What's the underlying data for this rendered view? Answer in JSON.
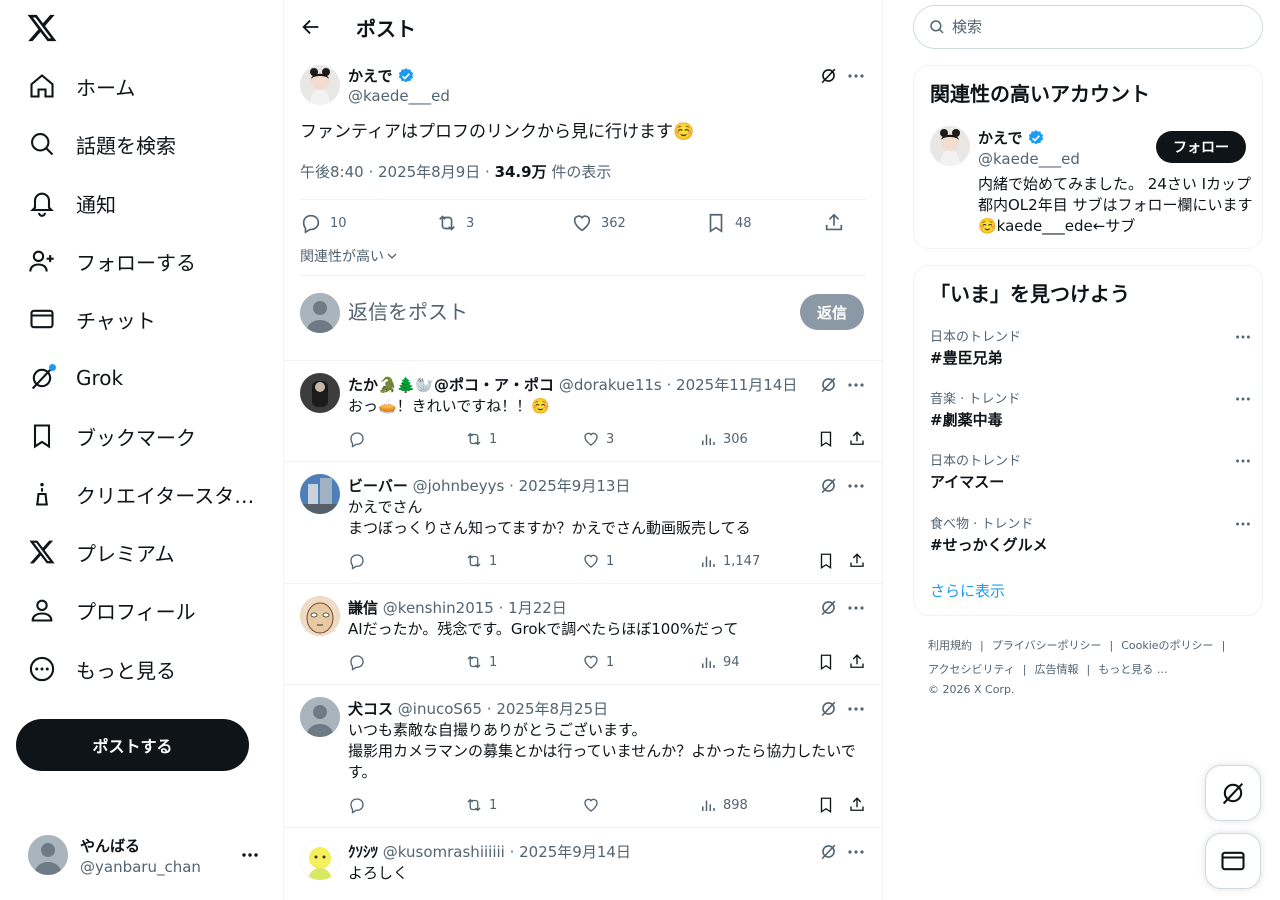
{
  "app": {
    "brand": "X",
    "accent": "#1d9bf0"
  },
  "nav": {
    "items": [
      {
        "label": "ホーム",
        "icon": "home-icon"
      },
      {
        "label": "話題を検索",
        "icon": "search-icon"
      },
      {
        "label": "通知",
        "icon": "bell-icon"
      },
      {
        "label": "フォローする",
        "icon": "add-user-icon"
      },
      {
        "label": "チャット",
        "icon": "mail-icon"
      },
      {
        "label": "Grok",
        "icon": "grok-icon"
      },
      {
        "label": "ブックマーク",
        "icon": "bookmark-icon"
      },
      {
        "label": "クリエイタースタジオ",
        "icon": "creator-studio-icon"
      },
      {
        "label": "プレミアム",
        "icon": "x-logo-icon"
      },
      {
        "label": "プロフィール",
        "icon": "profile-icon"
      },
      {
        "label": "もっと見る",
        "icon": "more-circle-icon"
      }
    ],
    "post_button": "ポストする",
    "account": {
      "display_name": "やんばる",
      "handle": "@yanbaru_chan"
    }
  },
  "main": {
    "title": "ポスト",
    "post": {
      "display_name": "かえで",
      "handle": "@kaede___ed",
      "text": "ファンティアはプロフのリンクから見に行けます☺️",
      "time": "午後8:40 · 2025年8月9日 · ",
      "views": "34.9万",
      "views_suffix": " 件の表示",
      "replies": "10",
      "reposts": "3",
      "likes": "362",
      "bookmarks": "48"
    },
    "sort_label": "関連性が高い",
    "reply_placeholder": "返信をポスト",
    "reply_button": "返信",
    "replies": [
      {
        "name": "たか🐊🌲🦭@ポコ・ア・ポコ",
        "handle": "@dorakue11s · 2025年11月14日",
        "text": "おっ🥧！きれいですね！！☺️",
        "replies": "",
        "reposts": "1",
        "likes": "3",
        "views": "306"
      },
      {
        "name": "ビーバー",
        "handle": "@johnbeyys · 2025年9月13日",
        "text": "かえでさん\nまつぼっくりさん知ってますか？かえでさん動画販売してる",
        "replies": "",
        "reposts": "1",
        "likes": "1",
        "views": "1,147"
      },
      {
        "name": "謙信",
        "handle": "@kenshin2015 · 1月22日",
        "text": "AIだったか。残念です。Grokで調べたらほぼ100%だって",
        "replies": "",
        "reposts": "1",
        "likes": "1",
        "views": "94"
      },
      {
        "name": "犬コス",
        "handle": "@inucoS65 · 2025年8月25日",
        "text": "いつも素敵な自撮りありがとうございます。\n撮影用カメラマンの募集とかは行っていませんか？よかったら協力したいです。",
        "replies": "",
        "reposts": "1",
        "likes": "",
        "views": "898"
      },
      {
        "name": "ｸｿｼﾂ",
        "handle": "@kusomrashiiiiii · 2025年9月14日",
        "text": "よろしく",
        "replies": "",
        "reposts": "",
        "likes": "",
        "views": ""
      }
    ]
  },
  "sidebar": {
    "search_placeholder": "検索",
    "related": {
      "title": "関連性の高いアカウント",
      "display_name": "かえで",
      "handle": "@kaede___ed",
      "follow": "フォロー",
      "bio": "内緒で始めてみました。 24さい Iカップ 都内OL2年目 サブはフォロー欄にいます☺️kaede___ede←サブ"
    },
    "trends": {
      "title": "「いま」を見つけよう",
      "items": [
        {
          "category": "日本のトレンド",
          "name": "#豊臣兄弟"
        },
        {
          "category": "音楽 · トレンド",
          "name": "#劇薬中毒"
        },
        {
          "category": "日本のトレンド",
          "name": "アイマスー"
        },
        {
          "category": "食べ物 · トレンド",
          "name": "#せっかくグルメ"
        }
      ],
      "show_more": "さらに表示"
    },
    "footer": {
      "terms": "利用規約",
      "privacy": "プライバシーポリシー",
      "cookie": "Cookieのポリシー",
      "accessibility": "アクセシビリティ",
      "ads": "広告情報",
      "more": "もっと見る …",
      "copyright": "© 2026 X Corp."
    }
  }
}
